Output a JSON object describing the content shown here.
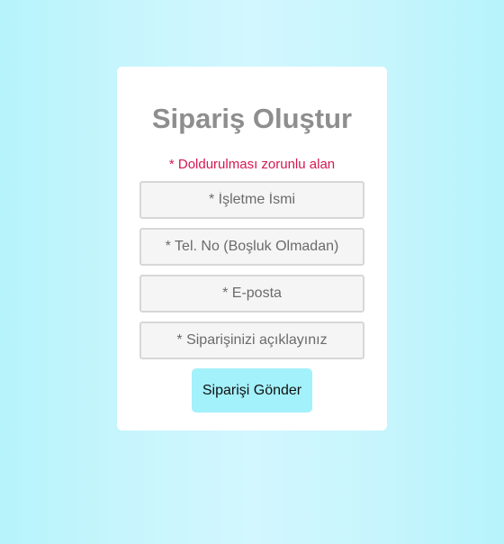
{
  "form": {
    "title": "Sipariş Oluştur",
    "required_note": "* Doldurulması zorunlu alan",
    "fields": [
      {
        "placeholder": "* İşletme İsmi",
        "value": ""
      },
      {
        "placeholder": "* Tel. No (Boşluk Olmadan)",
        "value": ""
      },
      {
        "placeholder": "* E-posta",
        "value": ""
      },
      {
        "placeholder": "* Siparişinizi açıklayınız",
        "value": ""
      }
    ],
    "submit_label": "Siparişi Gönder"
  },
  "colors": {
    "background_edge": "#b6f3fb",
    "background_center": "#d2f7fe",
    "card": "#ffffff",
    "title_text": "#8e8e8e",
    "required_note_text": "#d6184f",
    "field_background": "#f5f5f5",
    "field_border": "#d7d7d7",
    "button_background": "#a3f1fb"
  }
}
